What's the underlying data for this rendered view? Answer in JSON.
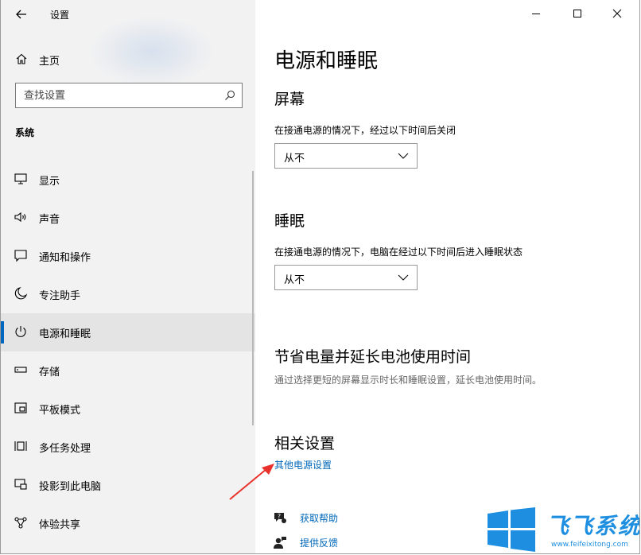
{
  "window": {
    "title": "设置"
  },
  "sidebar": {
    "home_label": "主页",
    "search_placeholder": "查找设置",
    "section_title": "系统",
    "items": [
      {
        "label": "显示",
        "icon": "monitor-icon"
      },
      {
        "label": "声音",
        "icon": "speaker-icon"
      },
      {
        "label": "通知和操作",
        "icon": "notification-icon"
      },
      {
        "label": "专注助手",
        "icon": "moon-icon"
      },
      {
        "label": "电源和睡眠",
        "icon": "power-icon",
        "active": true
      },
      {
        "label": "存储",
        "icon": "storage-icon"
      },
      {
        "label": "平板模式",
        "icon": "tablet-mode-icon"
      },
      {
        "label": "多任务处理",
        "icon": "multitasking-icon"
      },
      {
        "label": "投影到此电脑",
        "icon": "projection-icon"
      },
      {
        "label": "体验共享",
        "icon": "share-icon"
      }
    ]
  },
  "main": {
    "page_title": "电源和睡眠",
    "screen": {
      "heading": "屏幕",
      "description": "在接通电源的情况下，经过以下时间后关闭",
      "value": "从不"
    },
    "sleep": {
      "heading": "睡眠",
      "description": "在接通电源的情况下，电脑在经过以下时间后进入睡眠状态",
      "value": "从不"
    },
    "battery": {
      "heading": "节省电量并延长电池使用时间",
      "description": "通过选择更短的屏幕显示时长和睡眠设置，延长电池使用时间。"
    },
    "related": {
      "heading": "相关设置",
      "link": "其他电源设置"
    },
    "help": {
      "get_help": "获取帮助",
      "feedback": "提供反馈"
    }
  },
  "watermark": {
    "brand": "飞飞系统",
    "url": "www.feifeixitong.com"
  },
  "colors": {
    "accent": "#0067c0",
    "link": "#0067b8",
    "sidebar_bg": "#f2f2f2",
    "arrow": "#e8322b",
    "watermark": "#1e8fe0"
  }
}
